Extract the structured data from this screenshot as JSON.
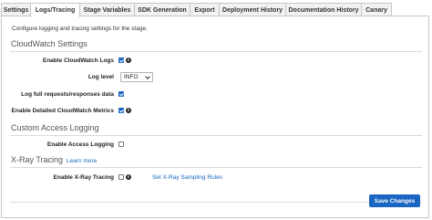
{
  "tabs": [
    {
      "label": "Settings",
      "active": false
    },
    {
      "label": "Logs/Tracing",
      "active": true
    },
    {
      "label": "Stage Variables",
      "active": false
    },
    {
      "label": "SDK Generation",
      "active": false
    },
    {
      "label": "Export",
      "active": false
    },
    {
      "label": "Deployment History",
      "active": false
    },
    {
      "label": "Documentation History",
      "active": false
    },
    {
      "label": "Canary",
      "active": false
    }
  ],
  "description": "Configure logging and tracing settings for the stage.",
  "cloudwatch": {
    "title": "CloudWatch Settings",
    "enable_logs_label": "Enable CloudWatch Logs",
    "enable_logs_checked": true,
    "log_level_label": "Log level",
    "log_level_value": "INFO",
    "full_requests_label": "Log full requests/responses data",
    "full_requests_checked": true,
    "detailed_metrics_label": "Enable Detailed CloudWatch Metrics",
    "detailed_metrics_checked": true
  },
  "access_logging": {
    "title": "Custom Access Logging",
    "enable_label": "Enable Access Logging",
    "enable_checked": false
  },
  "xray": {
    "title": "X-Ray Tracing",
    "learn_more": "Learn more",
    "enable_label": "Enable X-Ray Tracing",
    "enable_checked": false,
    "sampling_link": "Set X-Ray Sampling Rules"
  },
  "save_label": "Save Changes",
  "colors": {
    "accent": "#1a66c2",
    "border": "#c6c6c6"
  },
  "icons": [
    "info-icon",
    "chevron-down-icon",
    "checkbox"
  ]
}
